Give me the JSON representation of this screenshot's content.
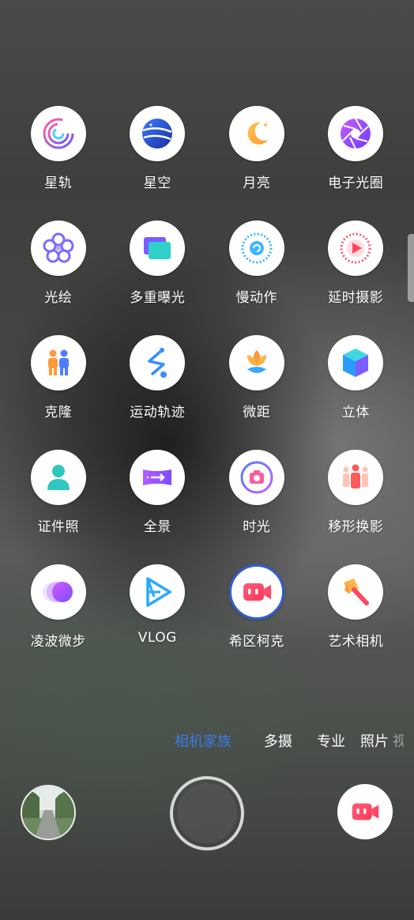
{
  "grid": {
    "items": [
      {
        "label": "星轨",
        "icon": "star-trails-icon"
      },
      {
        "label": "星空",
        "icon": "starry-sky-planet-icon"
      },
      {
        "label": "月亮",
        "icon": "moon-icon"
      },
      {
        "label": "电子光圈",
        "icon": "aperture-icon"
      },
      {
        "label": "光绘",
        "icon": "light-painting-flower-icon"
      },
      {
        "label": "多重曝光",
        "icon": "multiple-exposure-icon"
      },
      {
        "label": "慢动作",
        "icon": "slow-motion-icon"
      },
      {
        "label": "延时摄影",
        "icon": "time-lapse-icon"
      },
      {
        "label": "克隆",
        "icon": "clone-people-icon"
      },
      {
        "label": "运动轨迹",
        "icon": "motion-track-icon"
      },
      {
        "label": "微距",
        "icon": "macro-flower-icon"
      },
      {
        "label": "立体",
        "icon": "3d-cube-icon"
      },
      {
        "label": "证件照",
        "icon": "id-photo-icon"
      },
      {
        "label": "全景",
        "icon": "panorama-icon"
      },
      {
        "label": "时光",
        "icon": "time-camera-icon"
      },
      {
        "label": "移形换影",
        "icon": "shape-shift-people-icon"
      },
      {
        "label": "凌波微步",
        "icon": "ripple-step-icon"
      },
      {
        "label": "VLOG",
        "icon": "vlog-play-icon"
      },
      {
        "label": "希区柯克",
        "icon": "hitchcock-video-icon",
        "selected": true
      },
      {
        "label": "艺术相机",
        "icon": "art-brush-icon"
      }
    ]
  },
  "modes": {
    "items": [
      "相机家族",
      "多摄",
      "专业",
      "照片",
      "视"
    ],
    "active": "相机家族"
  },
  "bottom": {
    "gallery_thumbnail": "gallery-thumbnail",
    "shutter": "shutter-button",
    "video": "video-mode-icon"
  },
  "colors": {
    "accent": "#3b78e7",
    "selected_ring": "#2f5fd0"
  }
}
